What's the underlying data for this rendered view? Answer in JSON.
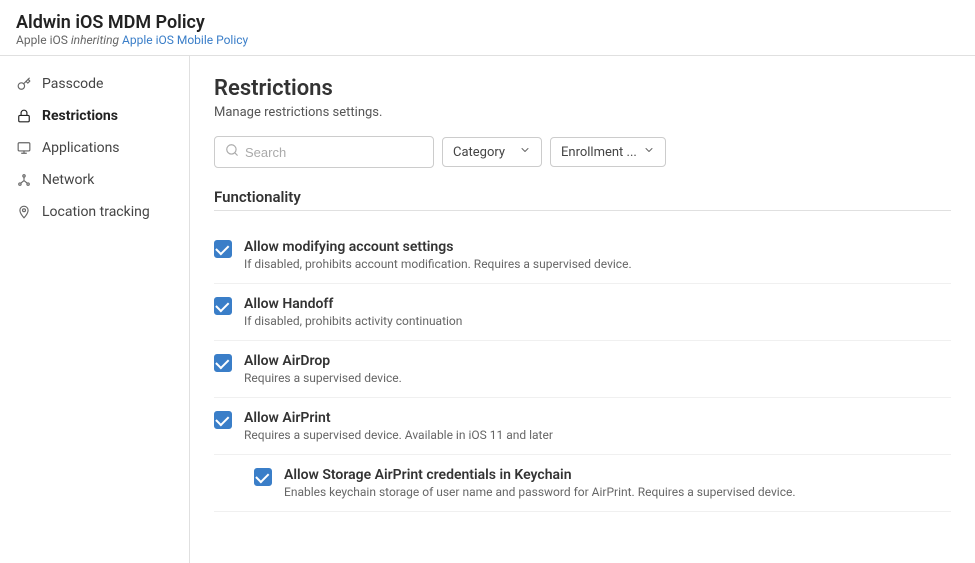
{
  "header": {
    "title": "Aldwin iOS MDM Policy",
    "subtitle_prefix": "Apple iOS ",
    "subtitle_italic": "inheriting ",
    "subtitle_link": "Apple iOS Mobile Policy"
  },
  "sidebar": {
    "items": [
      {
        "id": "passcode",
        "label": "Passcode",
        "icon": "key"
      },
      {
        "id": "restrictions",
        "label": "Restrictions",
        "icon": "lock",
        "active": true
      },
      {
        "id": "applications",
        "label": "Applications",
        "icon": "monitor"
      },
      {
        "id": "network",
        "label": "Network",
        "icon": "network"
      },
      {
        "id": "location",
        "label": "Location tracking",
        "icon": "pin"
      }
    ]
  },
  "content": {
    "title": "Restrictions",
    "subtitle": "Manage restrictions settings.",
    "search_placeholder": "Search",
    "category_label": "Category",
    "enrollment_label": "Enrollment ...",
    "section_title": "Functionality",
    "settings": [
      {
        "id": "allow_modifying",
        "label": "Allow modifying account settings",
        "description": "If disabled, prohibits account modification. Requires a supervised device.",
        "checked": true,
        "indented": false
      },
      {
        "id": "allow_handoff",
        "label": "Allow Handoff",
        "description": "If disabled, prohibits activity continuation",
        "checked": true,
        "indented": false
      },
      {
        "id": "allow_airdrop",
        "label": "Allow AirDrop",
        "description": "Requires a supervised device.",
        "checked": true,
        "indented": false
      },
      {
        "id": "allow_airprint",
        "label": "Allow AirPrint",
        "description": "Requires a supervised device. Available in iOS 11 and later",
        "checked": true,
        "indented": false
      },
      {
        "id": "allow_storage_airprint",
        "label": "Allow Storage AirPrint credentials in Keychain",
        "description": "Enables keychain storage of user name and password for AirPrint. Requires a supervised device.",
        "checked": true,
        "indented": true
      }
    ]
  }
}
